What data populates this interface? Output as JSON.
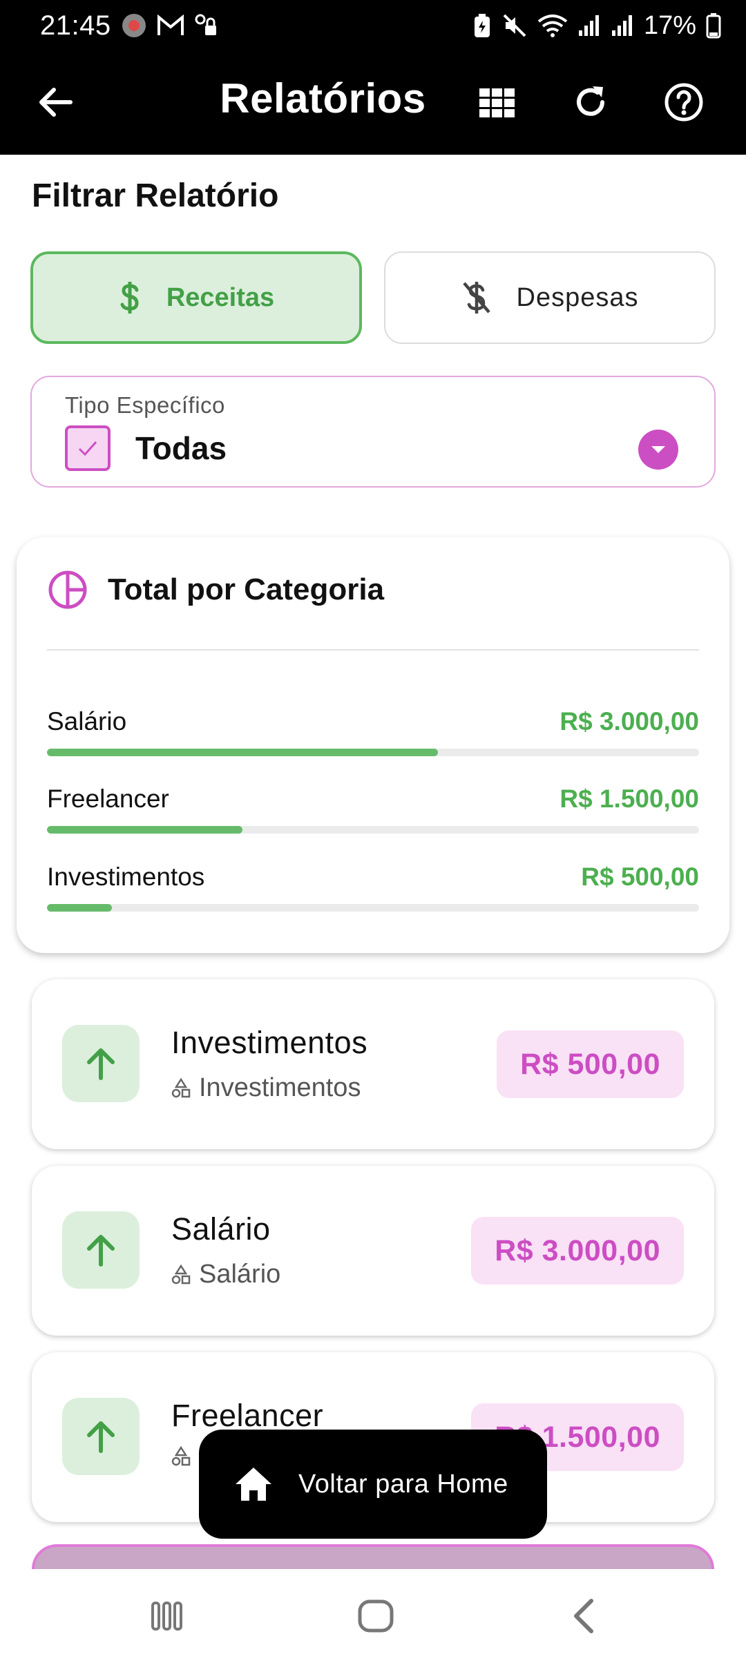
{
  "status_bar": {
    "time": "21:45",
    "battery": "17%"
  },
  "app_bar": {
    "title": "Relatórios",
    "icons": [
      "back-arrow-icon",
      "grid-icon",
      "refresh-icon",
      "help-icon"
    ]
  },
  "filter": {
    "section_title": "Filtrar Relatório",
    "income_label": "Receitas",
    "expense_label": "Despesas",
    "selected": "Receitas",
    "type_label": "Tipo Específico",
    "type_value": "Todas"
  },
  "totals": {
    "title": "Total por Categoria",
    "items": [
      {
        "name": "Salário",
        "amount": "R$ 3.000,00",
        "value": 3000,
        "share": 0.6
      },
      {
        "name": "Freelancer",
        "amount": "R$ 1.500,00",
        "value": 1500,
        "share": 0.3
      },
      {
        "name": "Investimentos",
        "amount": "R$ 500,00",
        "value": 500,
        "share": 0.1
      }
    ]
  },
  "transactions": [
    {
      "name": "Investimentos",
      "category": "Investimentos",
      "amount": "R$ 500,00"
    },
    {
      "name": "Salário",
      "category": "Salário",
      "amount": "R$ 3.000,00"
    },
    {
      "name": "Freelancer",
      "category": "",
      "amount": "R$ 1.500,00"
    }
  ],
  "home_button": {
    "label": "Voltar para Home"
  },
  "colors": {
    "income_green": "#4caf50",
    "accent_pink": "#cc4ec3",
    "pill_bg": "#f9e1f6",
    "app_bar_bg": "#000000"
  }
}
